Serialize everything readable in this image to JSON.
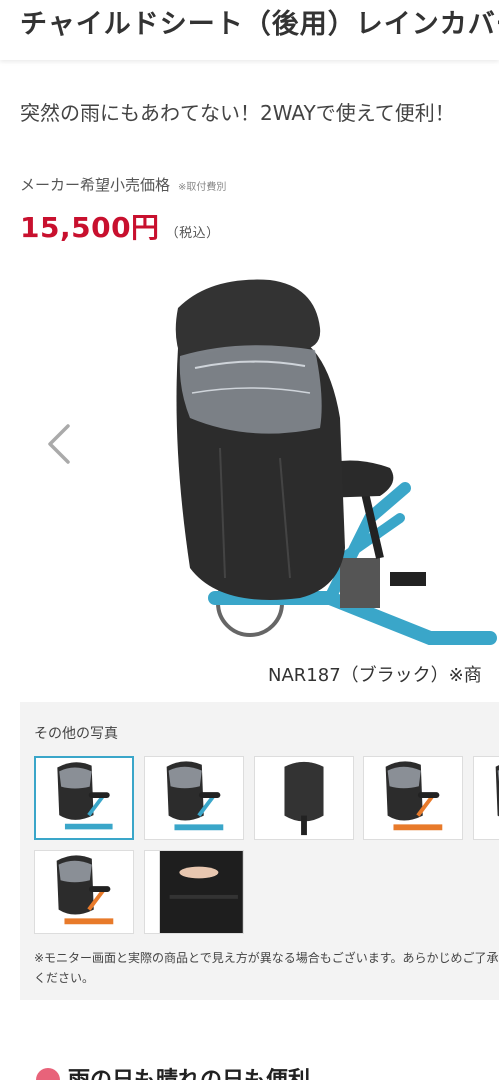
{
  "product": {
    "title": "チャイルドシート（後用）レインカバー",
    "catchphrase": "突然の雨にもあわてない！2WAYで使えて便利！",
    "price_label": "メーカー希望小売価格",
    "price_note": "※取付費別",
    "price": "15,500円",
    "tax_label": "（税込）",
    "caption": "NAR187（ブラック）※商"
  },
  "gallery": {
    "title": "その他の写真",
    "thumbnails": [
      {
        "label": "thumb-1",
        "accent": "#3aa6c9",
        "active": true
      },
      {
        "label": "thumb-2",
        "accent": "#3aa6c9",
        "active": false
      },
      {
        "label": "thumb-3",
        "accent": "#333333",
        "active": false
      },
      {
        "label": "thumb-4",
        "accent": "#e87a2a",
        "active": false
      },
      {
        "label": "thumb-5",
        "accent": "#888888",
        "active": false
      },
      {
        "label": "thumb-6",
        "accent": "#e87a2a",
        "active": false
      },
      {
        "label": "thumb-7",
        "accent": "#222222",
        "active": false
      }
    ],
    "note": "※モニター画面と実際の商品とで見え方が異なる場合もございます。あらかじめご了承ください。"
  },
  "section": {
    "heading": "雨の日も晴れの日も便利"
  },
  "colors": {
    "price": "#c8102e",
    "active_border": "#3aa6c9",
    "heading_dot": "#e8637a",
    "bike_frame": "#3aa6c9"
  },
  "icons": {
    "prev": "chevron-left-icon"
  }
}
